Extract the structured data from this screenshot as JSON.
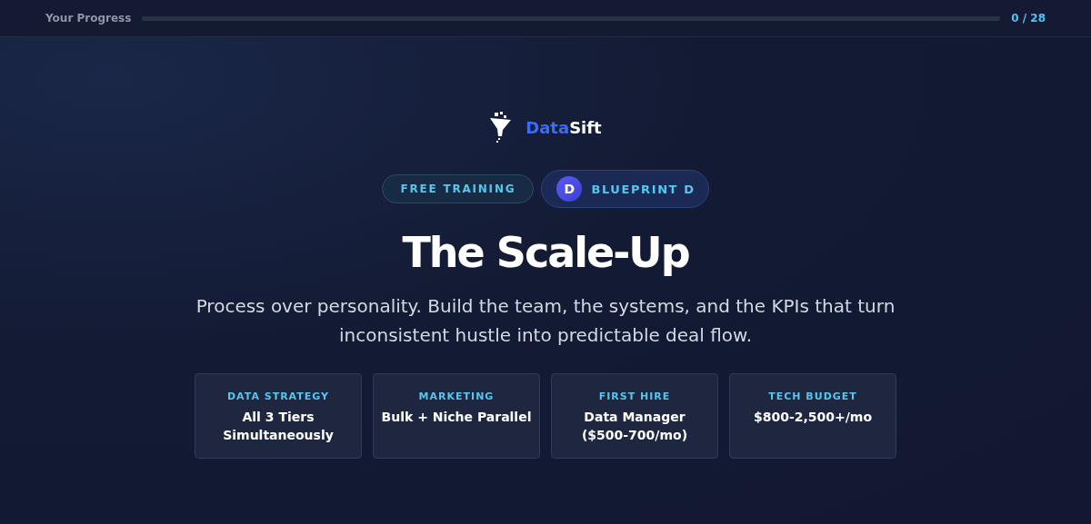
{
  "progress": {
    "label": "Your Progress",
    "level": 0,
    "count": "0 / 28"
  },
  "brand": {
    "first": "Data",
    "second": "Sift"
  },
  "badges": [
    {
      "kind": "plain",
      "label": "FREE TRAINING"
    },
    {
      "kind": "avatar",
      "initial": "D",
      "label": "BLUEPRINT D"
    }
  ],
  "title": "The Scale-Up",
  "subtitle": "Process over personality. Build the team, the systems, and the KPIs that turn inconsistent hustle into predictable deal flow.",
  "cards": [
    {
      "label": "DATA STRATEGY",
      "value": "All 3 Tiers Simultaneously"
    },
    {
      "label": "MARKETING",
      "value": "Bulk + Niche Parallel"
    },
    {
      "label": "FIRST HIRE",
      "value": "Data Manager ($500-700/mo)"
    },
    {
      "label": "TECH BUDGET",
      "value": "$800-2,500+/mo"
    }
  ]
}
